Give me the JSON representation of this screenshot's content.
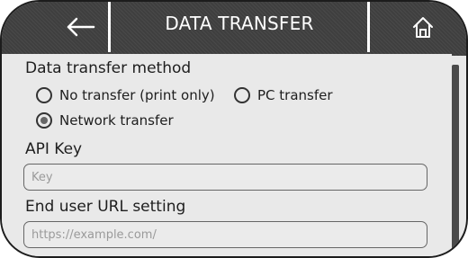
{
  "header": {
    "title": "DATA TRANSFER",
    "back_icon": "arrow-left-icon",
    "home_icon": "home-icon"
  },
  "form": {
    "method_label": "Data transfer method",
    "options": [
      {
        "label": "No transfer (print only)",
        "checked": false
      },
      {
        "label": "PC transfer",
        "checked": false
      },
      {
        "label": "Network transfer",
        "checked": true
      }
    ],
    "api_key_label": "API Key",
    "api_key_value": "",
    "api_key_placeholder": "Key",
    "url_label": "End user URL setting",
    "url_value": "",
    "url_placeholder": "https://example.com/"
  },
  "colors": {
    "titlebar": "#3f3f3f",
    "background": "#e9e9e9",
    "text": "#1e1e1e",
    "scrollbar": "#4a4a4a"
  }
}
